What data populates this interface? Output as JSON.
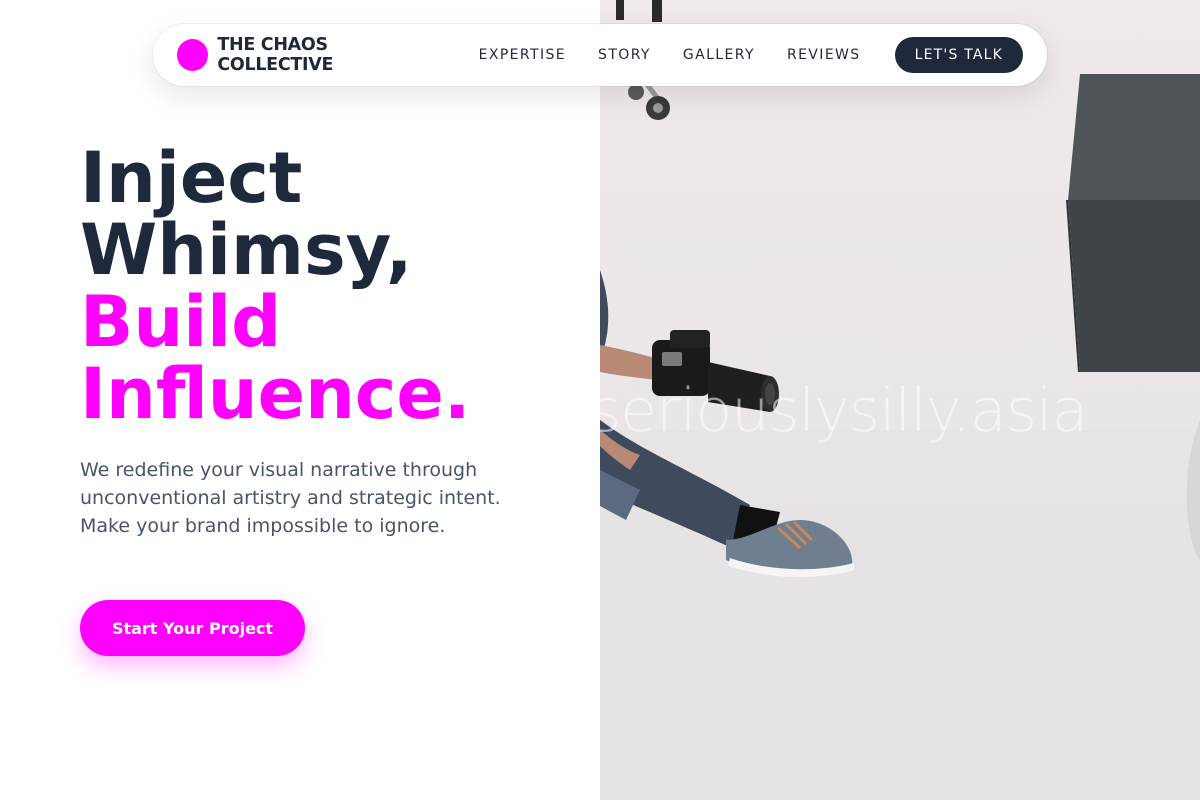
{
  "nav": {
    "brand_name": "THE CHAOS COLLECTIVE",
    "links": [
      "EXPERTISE",
      "STORY",
      "GALLERY",
      "REVIEWS"
    ],
    "cta_label": "LET'S TALK"
  },
  "hero": {
    "title_line1": "Inject",
    "title_line2": "Whimsy,",
    "title_line3": "Build",
    "title_line4": "Influence.",
    "description": "We redefine your visual narrative through unconventional artistry and strategic intent. Make your brand impossible to ignore.",
    "cta_label": "Start Your Project"
  },
  "photo": {
    "watermark": "seriouslysilly.asia"
  },
  "colors": {
    "accent": "#ff00ff",
    "dark": "#1e293b",
    "body_text": "#475569"
  },
  "icons": {
    "brand": "magenta-dot-logo"
  }
}
